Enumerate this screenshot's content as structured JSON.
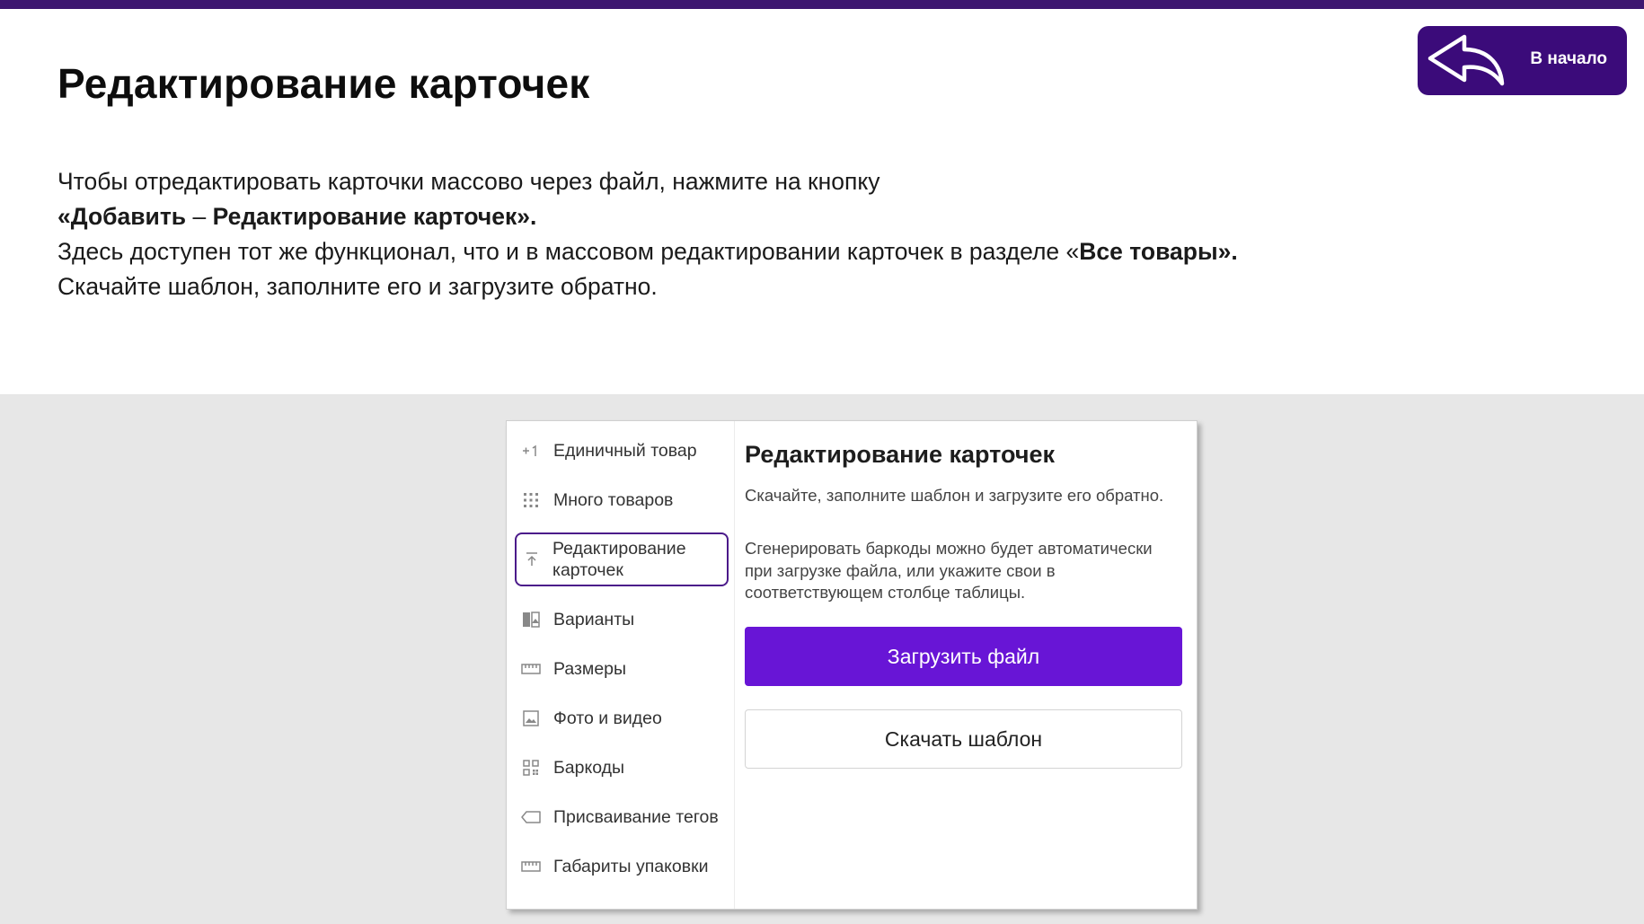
{
  "header": {
    "title": "Редактирование карточек",
    "home_button_label": "В начало",
    "accent_color": "#3b0b7a"
  },
  "intro": {
    "line1": "Чтобы отредактировать карточки массово через файл, нажмите на кнопку",
    "line2_open": "«",
    "line2_bold_a": "Добавить",
    "line2_dash": " – ",
    "line2_bold_b": "Редактирование карточек",
    "line2_close": "».",
    "line3_start": "Здесь доступен тот же функционал, что и в массовом редактировании карточек в разделе «",
    "line3_bold": "Все товары",
    "line3_end": "».",
    "line4": "Скачайте шаблон, заполните его и загрузите обратно."
  },
  "menu": {
    "items": [
      {
        "label": "Единичный товар",
        "icon": "plus-one-icon"
      },
      {
        "label": "Много товаров",
        "icon": "grid-dots-icon"
      },
      {
        "label": "Редактирование карточек",
        "icon": "upload-icon",
        "active": true
      },
      {
        "label": "Варианты",
        "icon": "variants-icon"
      },
      {
        "label": "Размеры",
        "icon": "ruler-icon"
      },
      {
        "label": "Фото и видео",
        "icon": "image-icon"
      },
      {
        "label": "Баркоды",
        "icon": "qr-icon"
      },
      {
        "label": "Присваивание тегов",
        "icon": "tag-icon"
      },
      {
        "label": "Габариты упаковки",
        "icon": "ruler-icon"
      }
    ]
  },
  "content": {
    "title": "Редактирование карточек",
    "desc1": "Скачайте, заполните шаблон и загрузите его обратно.",
    "desc2": "Сгенерировать баркоды можно будет автоматически при загрузке файла, или укажите свои в соответствующем столбце таблицы.",
    "upload_button": "Загрузить файл",
    "download_button": "Скачать шаблон",
    "primary_color": "#6815d6"
  }
}
